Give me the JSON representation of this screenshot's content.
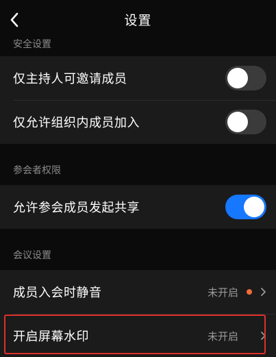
{
  "header": {
    "title": "设置",
    "back_icon": "chevron-left-icon"
  },
  "sections": {
    "security": {
      "label": "安全设置",
      "items": [
        {
          "label": "仅主持人可邀请成员",
          "toggle": false
        },
        {
          "label": "仅允许组织内成员加入",
          "toggle": false
        }
      ]
    },
    "participants": {
      "label": "参会者权限",
      "items": [
        {
          "label": "允许参会成员发起共享",
          "toggle": true
        }
      ]
    },
    "meeting": {
      "label": "会议设置",
      "items": [
        {
          "label": "成员入会时静音",
          "value": "未开启",
          "has_dot": true
        },
        {
          "label": "开启屏幕水印",
          "value": "未开启",
          "has_dot": false
        }
      ]
    }
  },
  "colors": {
    "accent": "#1677ff",
    "dot": "#f26b3a",
    "highlight": "#e0302a"
  }
}
